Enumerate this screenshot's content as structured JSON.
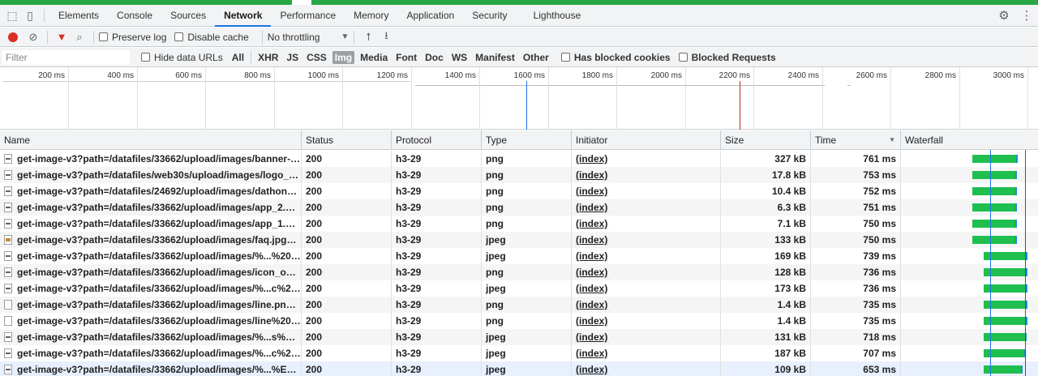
{
  "tabs": {
    "items": [
      "Elements",
      "Console",
      "Sources",
      "Network",
      "Performance",
      "Memory",
      "Application",
      "Security",
      "Lighthouse"
    ],
    "active": "Network"
  },
  "toolbar": {
    "preserve_log": "Preserve log",
    "disable_cache": "Disable cache",
    "throttling": "No throttling"
  },
  "filter": {
    "placeholder": "Filter",
    "hide_data_urls": "Hide data URLs",
    "types": [
      "All",
      "XHR",
      "JS",
      "CSS",
      "Img",
      "Media",
      "Font",
      "Doc",
      "WS",
      "Manifest",
      "Other"
    ],
    "active_type": "Img",
    "has_blocked_cookies": "Has blocked cookies",
    "blocked_requests": "Blocked Requests"
  },
  "overview": {
    "ticks": [
      "200 ms",
      "400 ms",
      "600 ms",
      "800 ms",
      "1000 ms",
      "1200 ms",
      "1400 ms",
      "1600 ms",
      "1800 ms",
      "2000 ms",
      "2200 ms",
      "2400 ms",
      "2600 ms",
      "2800 ms",
      "3000 ms"
    ]
  },
  "columns": {
    "name": "Name",
    "status": "Status",
    "protocol": "Protocol",
    "type": "Type",
    "initiator": "Initiator",
    "size": "Size",
    "time": "Time",
    "waterfall": "Waterfall"
  },
  "rows": [
    {
      "name": "get-image-v3?path=/datafiles/33662/upload/images/banner-01...",
      "status": "200",
      "protocol": "h3-29",
      "type": "png",
      "initiator": "(index)",
      "size": "327 kB",
      "time": "761 ms",
      "icon": "png"
    },
    {
      "name": "get-image-v3?path=/datafiles/web30s/upload/images/logo_web...",
      "status": "200",
      "protocol": "h3-29",
      "type": "png",
      "initiator": "(index)",
      "size": "17.8 kB",
      "time": "753 ms",
      "icon": "png"
    },
    {
      "name": "get-image-v3?path=/datafiles/24692/upload/images/dathongba...",
      "status": "200",
      "protocol": "h3-29",
      "type": "png",
      "initiator": "(index)",
      "size": "10.4 kB",
      "time": "752 ms",
      "icon": "png"
    },
    {
      "name": "get-image-v3?path=/datafiles/33662/upload/images/app_2.png...",
      "status": "200",
      "protocol": "h3-29",
      "type": "png",
      "initiator": "(index)",
      "size": "6.3 kB",
      "time": "751 ms",
      "icon": "png"
    },
    {
      "name": "get-image-v3?path=/datafiles/33662/upload/images/app_1.png...",
      "status": "200",
      "protocol": "h3-29",
      "type": "png",
      "initiator": "(index)",
      "size": "7.1 kB",
      "time": "750 ms",
      "icon": "png"
    },
    {
      "name": "get-image-v3?path=/datafiles/33662/upload/images/faq.jpg&wi...",
      "status": "200",
      "protocol": "h3-29",
      "type": "jpeg",
      "initiator": "(index)",
      "size": "133 kB",
      "time": "750 ms",
      "icon": "jpg"
    },
    {
      "name": "get-image-v3?path=/datafiles/33662/upload/images/%...%20s%...",
      "status": "200",
      "protocol": "h3-29",
      "type": "jpeg",
      "initiator": "(index)",
      "size": "169 kB",
      "time": "739 ms",
      "icon": "png"
    },
    {
      "name": "get-image-v3?path=/datafiles/33662/upload/images/icon_ong-...",
      "status": "200",
      "protocol": "h3-29",
      "type": "png",
      "initiator": "(index)",
      "size": "128 kB",
      "time": "736 ms",
      "icon": "png"
    },
    {
      "name": "get-image-v3?path=/datafiles/33662/upload/images/%...c%20s...",
      "status": "200",
      "protocol": "h3-29",
      "type": "jpeg",
      "initiator": "(index)",
      "size": "173 kB",
      "time": "736 ms",
      "icon": "png"
    },
    {
      "name": "get-image-v3?path=/datafiles/33662/upload/images/line.png&...",
      "status": "200",
      "protocol": "h3-29",
      "type": "png",
      "initiator": "(index)",
      "size": "1.4 kB",
      "time": "735 ms",
      "icon": "blank"
    },
    {
      "name": "get-image-v3?path=/datafiles/33662/upload/images/line%20(1)...",
      "status": "200",
      "protocol": "h3-29",
      "type": "png",
      "initiator": "(index)",
      "size": "1.4 kB",
      "time": "735 ms",
      "icon": "blank"
    },
    {
      "name": "get-image-v3?path=/datafiles/33662/upload/images/%...s%E1%...",
      "status": "200",
      "protocol": "h3-29",
      "type": "jpeg",
      "initiator": "(index)",
      "size": "131 kB",
      "time": "718 ms",
      "icon": "png"
    },
    {
      "name": "get-image-v3?path=/datafiles/33662/upload/images/%...c%20s...",
      "status": "200",
      "protocol": "h3-29",
      "type": "jpeg",
      "initiator": "(index)",
      "size": "187 kB",
      "time": "707 ms",
      "icon": "png"
    },
    {
      "name": "get-image-v3?path=/datafiles/33662/upload/images/%...%E1%B...",
      "status": "200",
      "protocol": "h3-29",
      "type": "jpeg",
      "initiator": "(index)",
      "size": "109 kB",
      "time": "653 ms",
      "icon": "png"
    }
  ],
  "colors": {
    "record": "#d93025",
    "waterfall_bar": "#1fbf4f",
    "waterfall_tail": "#1a8fd8",
    "dom_content_loaded": "#1a73e8",
    "load": "#c5221f"
  }
}
